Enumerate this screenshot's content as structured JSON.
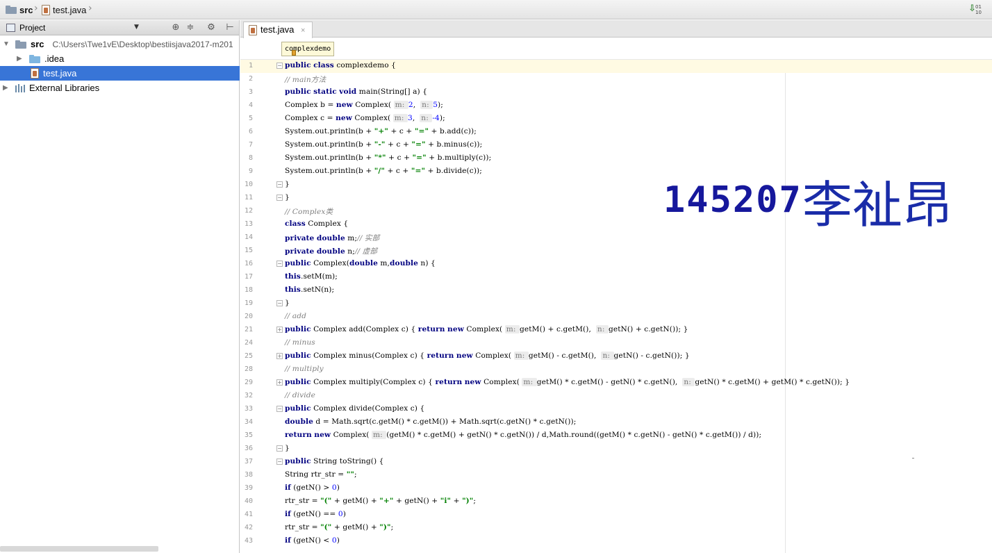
{
  "topbar": {
    "crumbs": [
      {
        "label": "src",
        "icon": "folder-icon"
      },
      {
        "label": "test.java",
        "icon": "java-file-icon"
      }
    ],
    "right_icon": "sort-download-icon",
    "right_icon_text": "01\n10"
  },
  "project_panel": {
    "title": "Project",
    "header_buttons": [
      "target-icon",
      "collapse-icon",
      "gear-icon",
      "pin-icon"
    ],
    "tree": [
      {
        "label": "src",
        "path": "C:\\Users\\Twe1vE\\Desktop\\bestiisjava2017-m201",
        "icon": "folder-icon",
        "expanded": true
      },
      {
        "label": ".idea",
        "icon": "folder-icon",
        "expanded": false
      },
      {
        "label": "test.java",
        "icon": "java-file-icon",
        "selected": true
      },
      {
        "label": "External Libraries",
        "icon": "library-icon",
        "expanded": false
      }
    ]
  },
  "editor": {
    "tab_label": "test.java",
    "tab_close": "×",
    "breadcrumb_chip": "complexdemo",
    "lines": [
      {
        "num": "1",
        "fold": "minus",
        "current": true,
        "code": "public class complexdemo {"
      },
      {
        "num": "2",
        "fold": "",
        "code": "// main方法"
      },
      {
        "num": "3",
        "fold": "",
        "code": "public static void main(String[] a) {"
      },
      {
        "num": "4",
        "fold": "",
        "code": "Complex b = new Complex( m: 2,  n: 5);"
      },
      {
        "num": "5",
        "fold": "",
        "code": "Complex c = new Complex( m: 3,  n: -4);"
      },
      {
        "num": "6",
        "fold": "",
        "code": "System.out.println(b + \"+\" + c + \"=\" + b.add(c));"
      },
      {
        "num": "7",
        "fold": "",
        "code": "System.out.println(b + \"-\" + c + \"=\" + b.minus(c));"
      },
      {
        "num": "8",
        "fold": "",
        "code": "System.out.println(b + \"*\" + c + \"=\" + b.multiply(c));"
      },
      {
        "num": "9",
        "fold": "",
        "code": "System.out.println(b + \"/\" + c + \"=\" + b.divide(c));"
      },
      {
        "num": "10",
        "fold": "minus",
        "code": "}"
      },
      {
        "num": "11",
        "fold": "minus",
        "code": "}"
      },
      {
        "num": "12",
        "fold": "",
        "code": "// Complex类"
      },
      {
        "num": "13",
        "fold": "",
        "code": "class Complex {"
      },
      {
        "num": "14",
        "fold": "",
        "code": "private double m;// 实部"
      },
      {
        "num": "15",
        "fold": "",
        "code": "private double n;// 虚部"
      },
      {
        "num": "16",
        "fold": "minus",
        "code": "public Complex(double m,double n) {"
      },
      {
        "num": "17",
        "fold": "",
        "code": "this.setM(m);"
      },
      {
        "num": "18",
        "fold": "",
        "code": "this.setN(n);"
      },
      {
        "num": "19",
        "fold": "minus",
        "code": "}"
      },
      {
        "num": "20",
        "fold": "",
        "code": "// add"
      },
      {
        "num": "21",
        "fold": "plus",
        "code": "public Complex add(Complex c) { return new Complex( m: getM() + c.getM(),  n: getN() + c.getN()); }"
      },
      {
        "num": "24",
        "fold": "",
        "code": "// minus"
      },
      {
        "num": "25",
        "fold": "plus",
        "code": "public Complex minus(Complex c) { return new Complex( m: getM() - c.getM(),  n: getN() - c.getN()); }"
      },
      {
        "num": "28",
        "fold": "",
        "code": "// multiply"
      },
      {
        "num": "29",
        "fold": "plus",
        "code": "public Complex multiply(Complex c) { return new Complex( m: getM() * c.getM() - getN() * c.getN(),  n: getN() * c.getM() + getM() * c.getN()); }"
      },
      {
        "num": "32",
        "fold": "",
        "code": "// divide"
      },
      {
        "num": "33",
        "fold": "minus",
        "code": "public Complex divide(Complex c) {"
      },
      {
        "num": "34",
        "fold": "",
        "code": "double d = Math.sqrt(c.getM() * c.getM()) + Math.sqrt(c.getN() * c.getN());"
      },
      {
        "num": "35",
        "fold": "",
        "code": "return new Complex( m: (getM() * c.getM() + getN() * c.getN()) / d,Math.round((getM() * c.getN() - getN() * c.getM()) / d));"
      },
      {
        "num": "36",
        "fold": "minus",
        "code": "}"
      },
      {
        "num": "37",
        "fold": "minus",
        "code": "public String toString() {"
      },
      {
        "num": "38",
        "fold": "",
        "code": "String rtr_str = \"\";"
      },
      {
        "num": "39",
        "fold": "",
        "code": "if (getN() > 0)"
      },
      {
        "num": "40",
        "fold": "",
        "code": "rtr_str = \"(\" + getM() + \"+\" + getN() + \"i\" + \")\";"
      },
      {
        "num": "41",
        "fold": "",
        "code": "if (getN() == 0)"
      },
      {
        "num": "42",
        "fold": "",
        "code": "rtr_str = \"(\" + getM() + \")\";"
      },
      {
        "num": "43",
        "fold": "",
        "code": "if (getN() < 0)"
      }
    ]
  },
  "overlay": {
    "digits": "145207",
    "name": "李祉昂"
  },
  "colors": {
    "keyword": "#000080",
    "string": "#008000",
    "comment": "#808080",
    "number": "#0000ff",
    "hint_bg": "#ececec",
    "selection": "#3875d7",
    "current_line": "#fffae3",
    "overlay_text": "#16189c"
  }
}
